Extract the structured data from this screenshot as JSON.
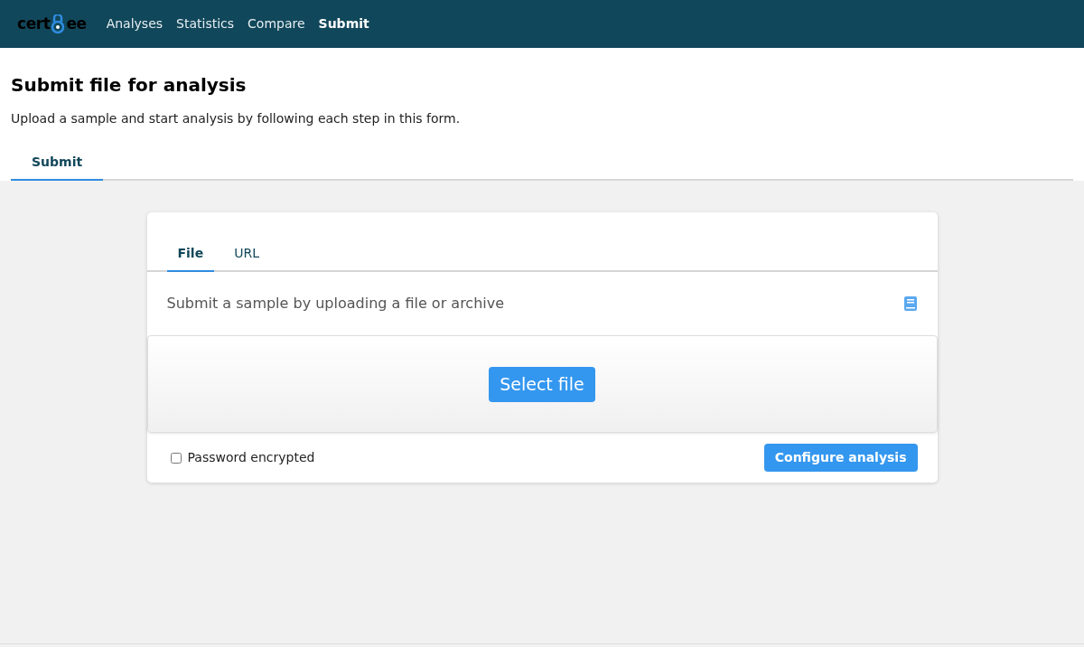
{
  "logo": {
    "left": "cert",
    "right": "ee"
  },
  "nav": [
    {
      "label": "Analyses",
      "selected": false
    },
    {
      "label": "Statistics",
      "selected": false
    },
    {
      "label": "Compare",
      "selected": false
    },
    {
      "label": "Submit",
      "selected": true
    }
  ],
  "page": {
    "title": "Submit file for analysis",
    "subtitle": "Upload a sample and start analysis by following each step in this form."
  },
  "page_tabs": [
    {
      "label": "Submit",
      "selected": true
    }
  ],
  "card": {
    "tabs": [
      {
        "label": "File",
        "selected": true
      },
      {
        "label": "URL",
        "selected": false
      }
    ],
    "heading": "Submit a sample by uploading a file or archive",
    "select_button": "Select file",
    "password": {
      "label": "Password encrypted",
      "checked": false
    },
    "configure_button": "Configure analysis"
  }
}
